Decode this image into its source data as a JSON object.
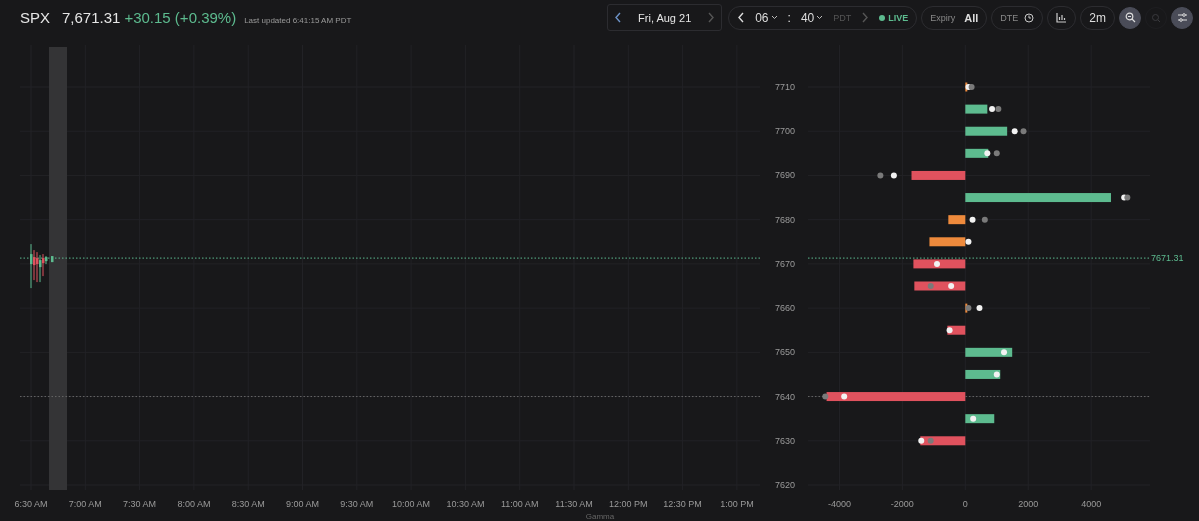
{
  "header": {
    "symbol": "SPX",
    "price": "7,671.31",
    "change": "+30.15 (+0.39%)",
    "last_updated": "Last updated 6:41:15 AM PDT"
  },
  "controls": {
    "date": "Fri, Aug 21",
    "hour": "06",
    "separator": ":",
    "minute": "40",
    "timezone": "PDT",
    "live": "LIVE",
    "expiry_label": "Expiry",
    "expiry_value": "All",
    "dte": "DTE",
    "interval": "2m"
  },
  "price_chart": {
    "time_labels": [
      "6:30 AM",
      "7:00 AM",
      "7:30 AM",
      "8:00 AM",
      "8:30 AM",
      "9:00 AM",
      "9:30 AM",
      "10:00 AM",
      "10:30 AM",
      "11:00 AM",
      "11:30 AM",
      "12:00 PM",
      "12:30 PM",
      "1:00 PM"
    ]
  },
  "gamma_chart": {
    "chart_data": {
      "type": "bar",
      "orientation": "horizontal",
      "grid": true,
      "xlabel": "Gamma",
      "ref_lines": [
        {
          "axis": "y",
          "value": 7671.31,
          "label": "7671.31",
          "color": "#5dbb8f"
        },
        {
          "axis": "y",
          "value": 7640,
          "color": "#666666"
        }
      ],
      "x": [
        7710,
        7705,
        7700,
        7695,
        7690,
        7685,
        7680,
        7675,
        7670,
        7665,
        7660,
        7655,
        7650,
        7645,
        7640,
        7635,
        7630
      ],
      "series": [
        {
          "type": "bar",
          "color": "#5dbb8f",
          "values": [
            null,
            700,
            1330,
            730,
            null,
            4630,
            null,
            null,
            null,
            null,
            null,
            null,
            1490,
            1110,
            null,
            920,
            null
          ]
        },
        {
          "type": "bar",
          "color": "#e0525e",
          "values": [
            null,
            null,
            null,
            null,
            -1710,
            null,
            null,
            null,
            -1650,
            -1620,
            null,
            -570,
            null,
            null,
            -4410,
            null,
            -1430
          ]
        },
        {
          "type": "bar",
          "color": "#ee8a3c",
          "values": [
            50,
            null,
            null,
            null,
            null,
            null,
            -540,
            -1140,
            null,
            null,
            30,
            null,
            null,
            null,
            null,
            null,
            null
          ]
        },
        {
          "type": "scatter",
          "color": "#f2f2f2",
          "values": [
            100,
            850,
            1570,
            700,
            -2270,
            5050,
            230,
            100,
            -900,
            -450,
            450,
            -500,
            1230,
            1000,
            -3850,
            250,
            -1400
          ]
        },
        {
          "type": "scatter",
          "color": "#7a7a7a",
          "values": [
            200,
            1050,
            1850,
            1000,
            -2700,
            5150,
            620,
            null,
            null,
            -1100,
            100,
            null,
            null,
            null,
            -4450,
            null,
            -1100
          ]
        }
      ],
      "xlim": [
        -5000,
        5870
      ],
      "ylim": [
        7620,
        7710
      ],
      "xticks": [
        -4000,
        -2000,
        0,
        2000,
        4000
      ],
      "yticks": [
        7710,
        7700,
        7690,
        7680,
        7670,
        7660,
        7650,
        7640,
        7630,
        7620
      ]
    }
  }
}
